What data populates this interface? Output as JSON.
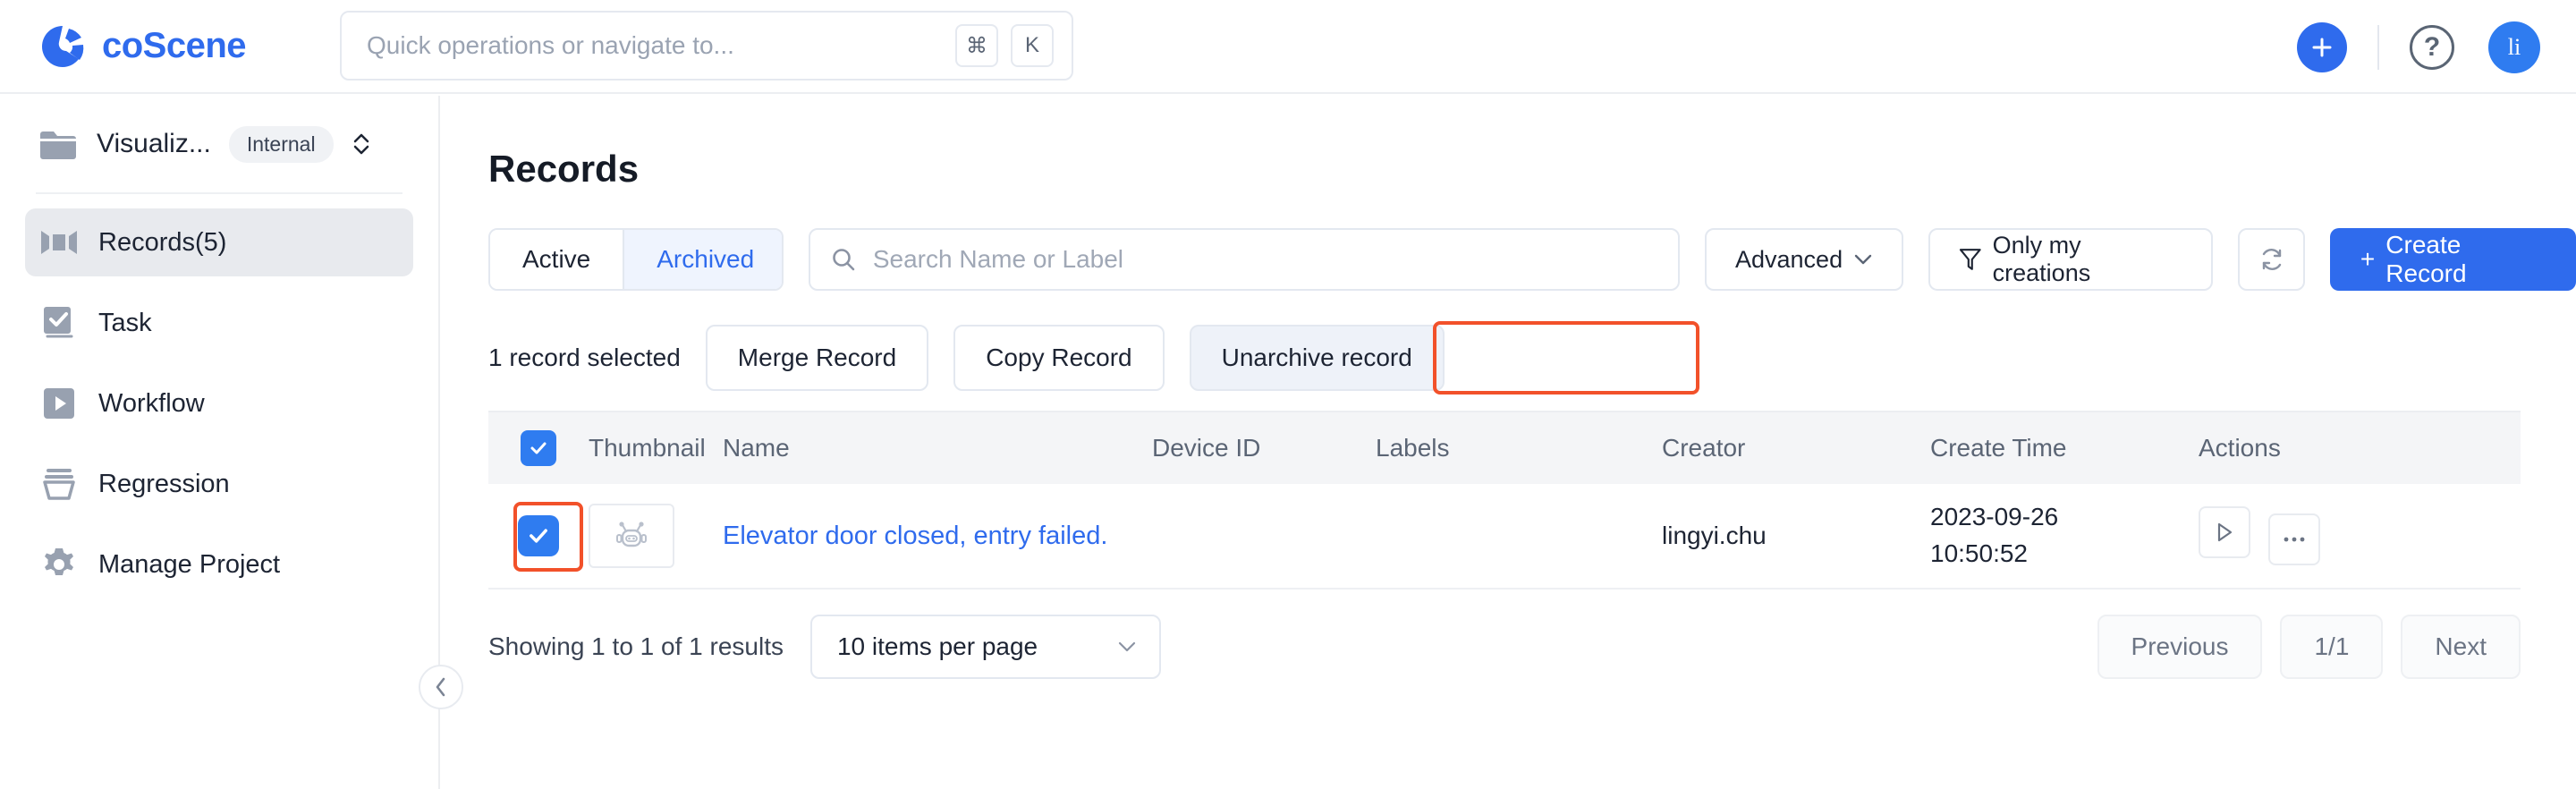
{
  "app": {
    "brand_name": "coScene",
    "logo_color": "#2f6bed"
  },
  "omnibox": {
    "placeholder": "Quick operations or navigate to...",
    "kbd_modifier": "⌘",
    "kbd_key": "K"
  },
  "topbar_right": {
    "add_label": "+",
    "help_label": "?",
    "avatar_initials": "li"
  },
  "sidebar": {
    "project_name": "Visualiz...",
    "project_badge": "Internal",
    "items": [
      {
        "label": "Records(5)",
        "icon": "records-icon",
        "active": true
      },
      {
        "label": "Task",
        "icon": "task-icon",
        "active": false
      },
      {
        "label": "Workflow",
        "icon": "workflow-icon",
        "active": false
      },
      {
        "label": "Regression",
        "icon": "regression-icon",
        "active": false
      },
      {
        "label": "Manage Project",
        "icon": "gear-icon",
        "active": false
      }
    ]
  },
  "main": {
    "page_title": "Records",
    "tabs": [
      {
        "label": "Active",
        "active": false
      },
      {
        "label": "Archived",
        "active": true
      }
    ],
    "search_placeholder": "Search Name or Label",
    "advanced_label": "Advanced",
    "only_my_creations_label": "Only my creations",
    "create_record_label": "Create Record",
    "create_record_prefix": "+",
    "selection": {
      "count_label": "1 record selected",
      "merge_label": "Merge Record",
      "copy_label": "Copy Record",
      "unarchive_label": "Unarchive record",
      "highlight_color": "#f2512a"
    },
    "table": {
      "columns": [
        "Thumbnail",
        "Name",
        "Device ID",
        "Labels",
        "Creator",
        "Create Time",
        "Actions"
      ],
      "rows": [
        {
          "selected": true,
          "thumbnail": "robot-icon",
          "name": "Elevator door closed, entry failed.",
          "device_id": "",
          "labels": "",
          "creator": "lingyi.chu",
          "create_date": "2023-09-26",
          "create_time": "10:50:52"
        }
      ]
    },
    "footer": {
      "showing": "Showing 1 to 1 of 1 results",
      "per_page": "10 items per page",
      "previous": "Previous",
      "page_indicator": "1/1",
      "next": "Next"
    }
  }
}
